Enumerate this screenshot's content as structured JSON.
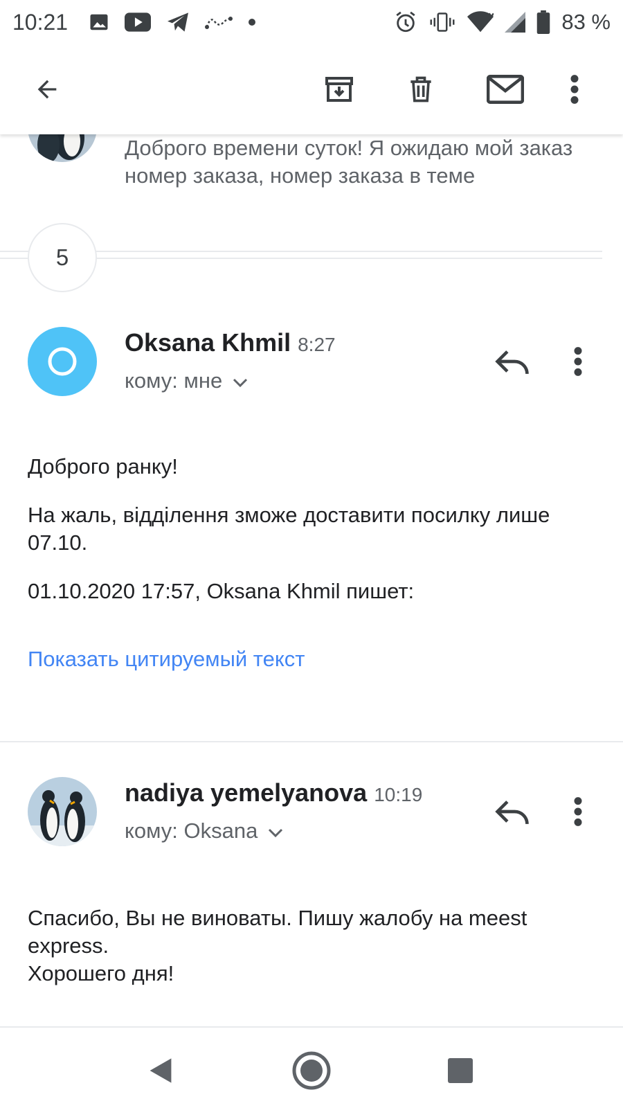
{
  "status_bar": {
    "time": "10:21",
    "battery_text": "83 %",
    "left_icons": [
      "image-icon",
      "youtube-icon",
      "telegram-icon",
      "route-icon",
      "dot-icon"
    ],
    "right_icons": [
      "alarm-icon",
      "vibrate-icon",
      "wifi-icon",
      "signal-icon",
      "battery-icon"
    ]
  },
  "app_bar": {
    "icons": [
      "back-arrow-icon",
      "archive-icon",
      "delete-icon",
      "mark-unread-icon",
      "more-vert-icon"
    ]
  },
  "previous_message": {
    "snippet": "Доброго времени суток! Я ожидаю мой заказ номер заказа, номер заказа в теме"
  },
  "collapsed": {
    "count": "5"
  },
  "message_1": {
    "sender": "Oksana Khmil",
    "time": "8:27",
    "to": "кому: мне",
    "body": [
      "Доброго ранку!",
      "На жаль, відділення зможе доставити посилку лише 07.10.",
      "01.10.2020 17:57, Oksana Khmil пишет:"
    ],
    "show_quoted": "Показать цитируемый текст",
    "avatar_color": "#4fc3f7"
  },
  "message_2": {
    "sender": "nadiya yemelyanova",
    "time": "10:19",
    "to": "кому: Oksana",
    "body": [
      "Спасибо, Вы не виноваты. Пишу жалобу на meest express.",
      "Хорошего дня!"
    ]
  },
  "nav_bar": {
    "icons": [
      "nav-back-icon",
      "nav-home-icon",
      "nav-recents-icon"
    ]
  },
  "colors": {
    "link": "#4285f4",
    "secondary_text": "#5f6368",
    "divider": "#e8eaed"
  }
}
